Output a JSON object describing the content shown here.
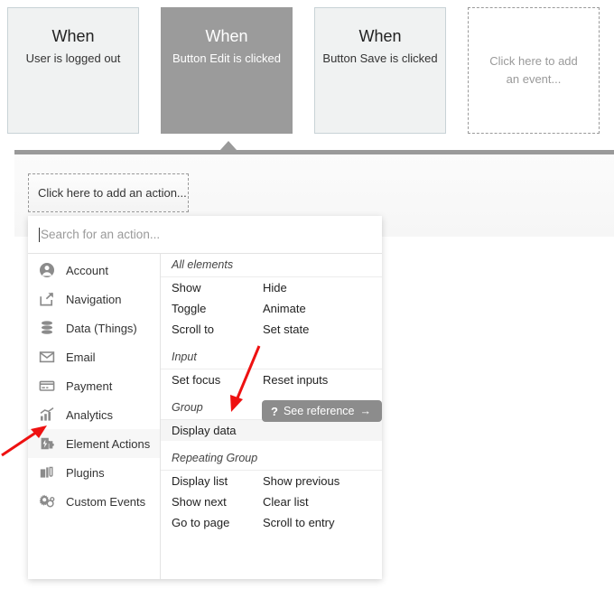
{
  "events": [
    {
      "when_label": "When",
      "description": "User is logged out",
      "state": "normal"
    },
    {
      "when_label": "When",
      "description": "Button Edit is clicked",
      "state": "selected"
    },
    {
      "when_label": "When",
      "description": "Button Save is clicked",
      "state": "normal"
    },
    {
      "placeholder": "Click here to add an event...",
      "state": "placeholder"
    }
  ],
  "workflow_panel": {
    "add_action_label": "Click here to add an action..."
  },
  "dropdown": {
    "search": {
      "placeholder": "Search for an action...",
      "value": ""
    },
    "categories": [
      {
        "label": "Account",
        "icon": "account-icon",
        "active": false
      },
      {
        "label": "Navigation",
        "icon": "navigation-icon",
        "active": false
      },
      {
        "label": "Data (Things)",
        "icon": "database-icon",
        "active": false
      },
      {
        "label": "Email",
        "icon": "email-icon",
        "active": false
      },
      {
        "label": "Payment",
        "icon": "payment-card-icon",
        "active": false
      },
      {
        "label": "Analytics",
        "icon": "analytics-icon",
        "active": false
      },
      {
        "label": "Element Actions",
        "icon": "element-actions-icon",
        "active": true
      },
      {
        "label": "Plugins",
        "icon": "plugins-icon",
        "active": false
      },
      {
        "label": "Custom Events",
        "icon": "custom-events-icon",
        "active": false
      }
    ],
    "sections": [
      {
        "title": "All elements",
        "rows": [
          {
            "left": "Show",
            "right": "Hide",
            "highlight": false
          },
          {
            "left": "Toggle",
            "right": "Animate",
            "highlight": false
          },
          {
            "left": "Scroll to",
            "right": "Set state",
            "highlight": false
          }
        ]
      },
      {
        "title": "Input",
        "rows": [
          {
            "left": "Set focus",
            "right": "Reset inputs",
            "highlight": false
          }
        ]
      },
      {
        "title": "Group",
        "rows": [
          {
            "left": "Display data",
            "right": "",
            "highlight": true
          }
        ]
      },
      {
        "title": "Repeating Group",
        "rows": [
          {
            "left": "Display list",
            "right": "Show previous",
            "highlight": false
          },
          {
            "left": "Show next",
            "right": "Clear list",
            "highlight": false
          },
          {
            "left": "Go to page",
            "right": "Scroll to entry",
            "highlight": false
          }
        ]
      }
    ],
    "see_reference": {
      "icon": "question-mark-icon",
      "label": "See reference",
      "arrow": "→"
    }
  },
  "annotations": {
    "arrow_color": "#ee1111",
    "arrows": [
      {
        "name": "arrow-to-element-actions"
      },
      {
        "name": "arrow-to-display-data"
      }
    ]
  },
  "colors": {
    "selected_event": "#9b9b9b",
    "event_card": "#f0f2f2",
    "event_border": "#c8d2d6",
    "panel_bar": "#9a9a9a",
    "tooltip_bg": "#8c8c8c",
    "annotation_red": "#ee1111"
  }
}
